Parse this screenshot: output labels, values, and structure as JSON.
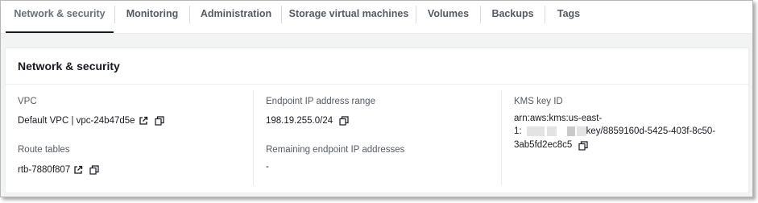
{
  "tabs": [
    {
      "label": "Network & security",
      "active": true
    },
    {
      "label": "Monitoring"
    },
    {
      "label": "Administration"
    },
    {
      "label": "Storage virtual machines"
    },
    {
      "label": "Volumes"
    },
    {
      "label": "Backups"
    },
    {
      "label": "Tags"
    }
  ],
  "panel": {
    "title": "Network & security",
    "vpc": {
      "label": "VPC",
      "value": "Default VPC | vpc-24b47d5e"
    },
    "route_tables": {
      "label": "Route tables",
      "value": "rtb-7880f807"
    },
    "endpoint_range": {
      "label": "Endpoint IP address range",
      "value": "198.19.255.0/24"
    },
    "remaining_endpoints": {
      "label": "Remaining endpoint IP addresses",
      "value": "-"
    },
    "kms": {
      "label": "KMS key ID",
      "line1": "arn:aws:kms:us-east-",
      "line2_prefix": "1:",
      "line2_suffix": "key/8859160d-5425-403f-8c50-",
      "line3": "3ab5fd2ec8c5"
    }
  },
  "colors": {
    "active_underline": "#16191f",
    "text_primary": "#16191f",
    "text_secondary": "#545b64",
    "background": "#f2f3f3"
  },
  "icons": [
    "external-link-icon",
    "copy-icon"
  ]
}
